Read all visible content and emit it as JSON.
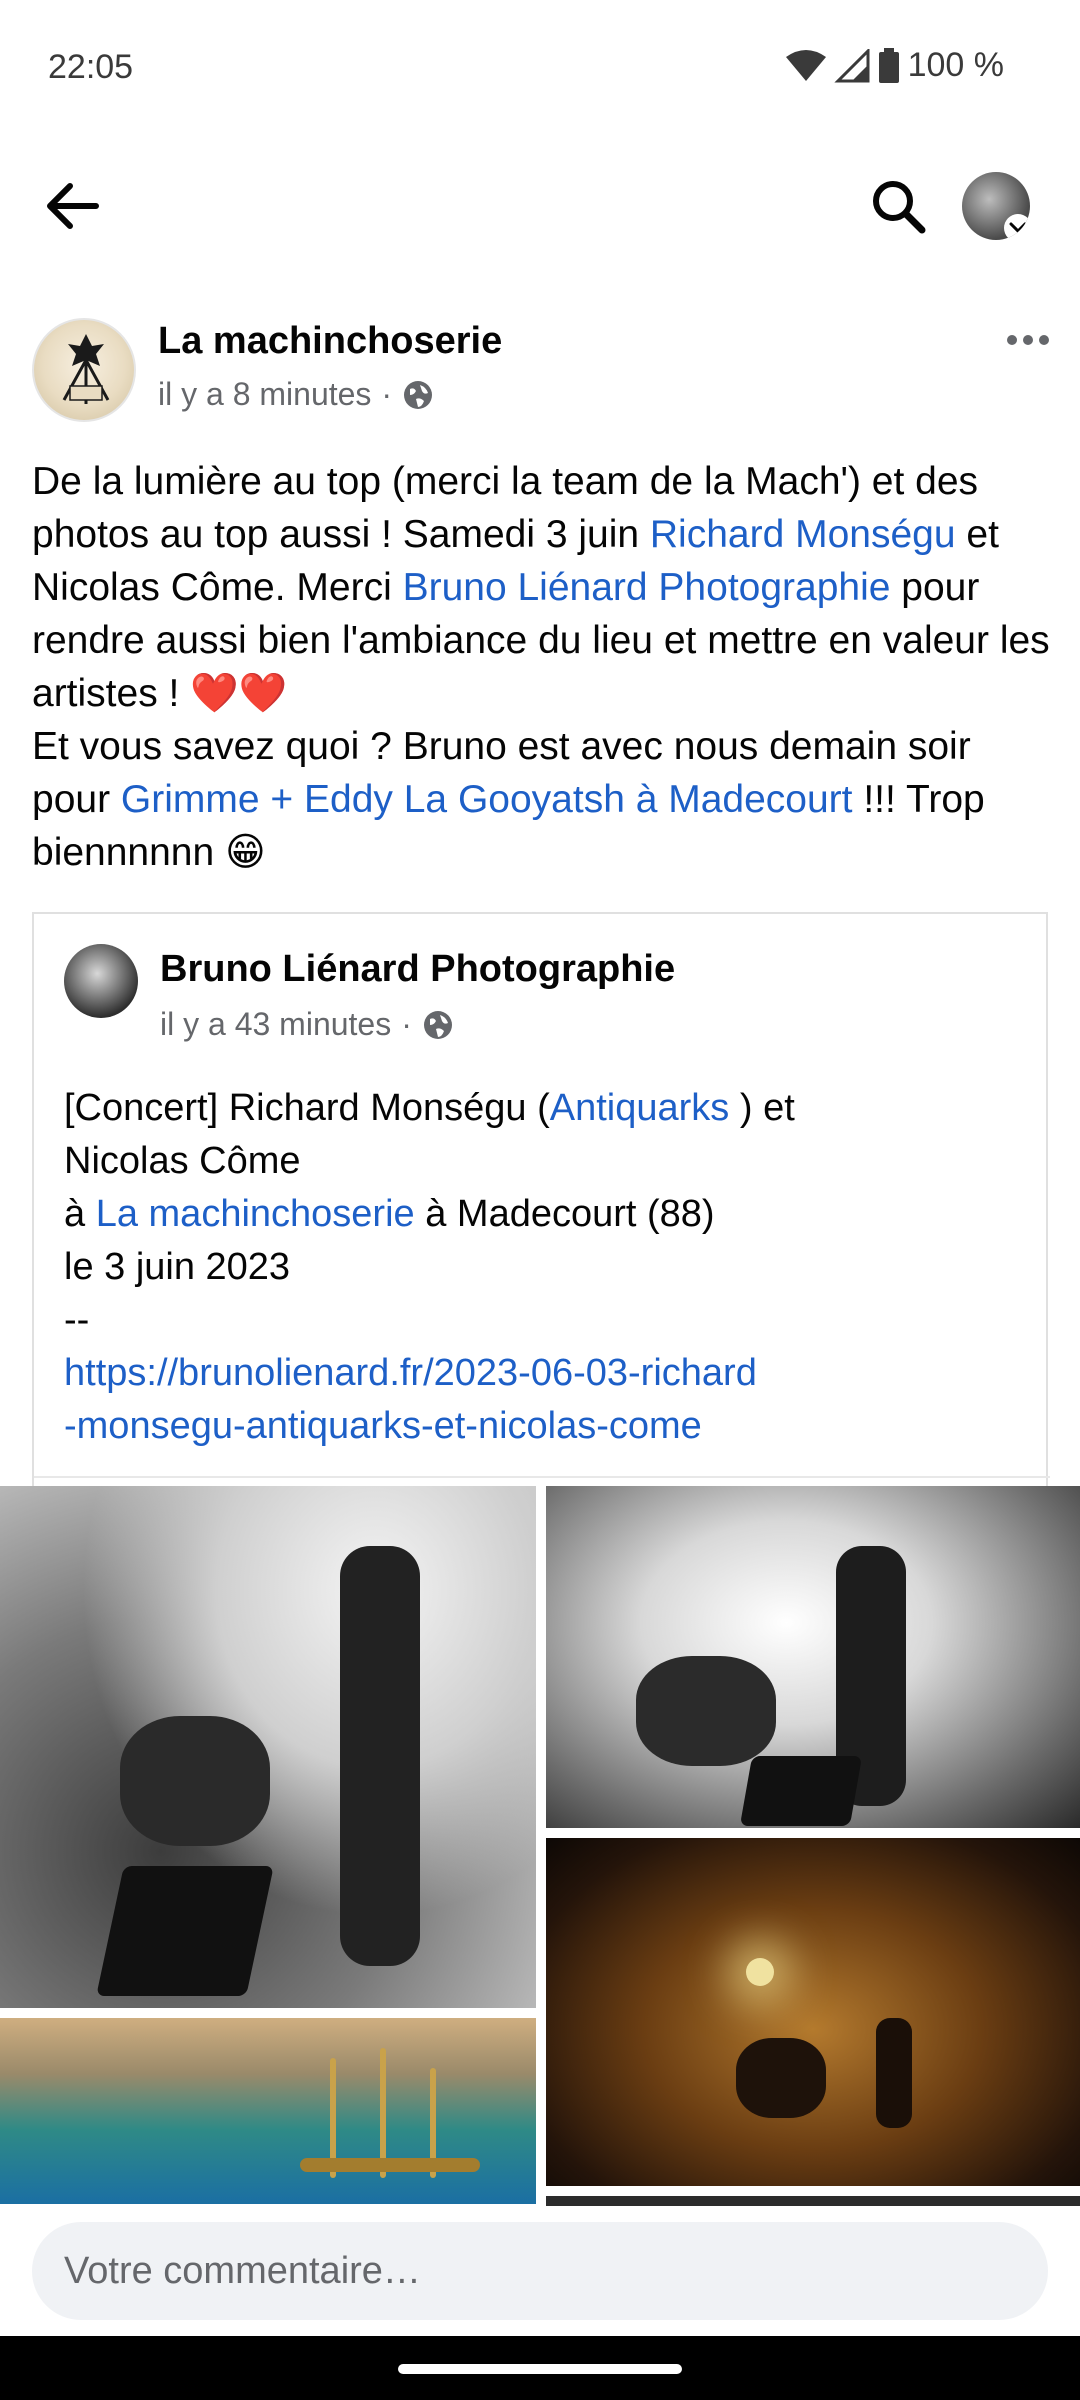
{
  "status_bar": {
    "time": "22:05",
    "battery": "100 %",
    "icons": [
      "wifi-icon",
      "signal-icon",
      "battery-icon"
    ]
  },
  "app_bar": {
    "icons": [
      "back-arrow-icon",
      "search-icon",
      "profile-avatar"
    ]
  },
  "post": {
    "page_name": "La machinchoserie",
    "time": "il y a 8 minutes",
    "separator": "·",
    "privacy_icon": "globe-icon",
    "text": {
      "p1_a": "De la lumière au top (merci la team de la Mach') et des photos au top aussi ! Samedi 3 juin ",
      "p1_link1": "Richard Monségu",
      "p1_b": " et Nicolas Côme. Merci ",
      "p1_link2": "Bruno Liénard Photographie",
      "p1_c": " pour rendre aussi bien l'ambiance du lieu et mettre en valeur les artistes ! ",
      "hearts": "❤️❤️",
      "p2_a": "Et vous savez quoi ? Bruno est avec nous demain soir pour ",
      "p2_link": "Grimme + Eddy La Gooyatsh à Madecourt",
      "p2_b": " !!! Trop biennnnnn ",
      "emoji": "😁"
    }
  },
  "shared": {
    "name": "Bruno Liénard Photographie",
    "time": "il y a 43 minutes",
    "separator": "·",
    "line1_a": "[Concert] Richard Monségu  (",
    "line1_link": "Antiquarks",
    "line1_b": " ) et",
    "line2": "Nicolas Côme",
    "line3_a": "à ",
    "line3_link": "La machinchoserie",
    "line3_b": " à Madecourt (88)",
    "line4": "le 3 juin 2023",
    "line5": "--",
    "url_1": "https://brunolienard.fr/2023-06-03-richard",
    "url_2": "-monsegu-antiquarks-et-nicolas-come"
  },
  "comment": {
    "placeholder": "Votre commentaire…"
  },
  "colors": {
    "link": "#1d5fc7",
    "meta": "#65676b",
    "text": "#050505",
    "input_bg": "#f0f2f5"
  }
}
